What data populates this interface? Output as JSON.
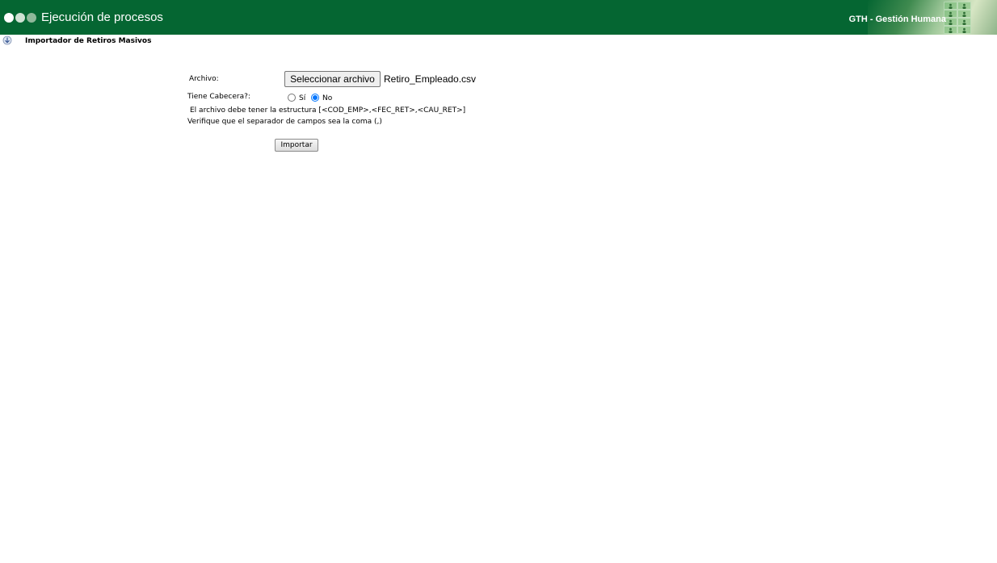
{
  "header": {
    "title": "Ejecución de procesos",
    "app_name": "GTH - Gestión Humana"
  },
  "section": {
    "title": "Importador de Retiros Masivos"
  },
  "form": {
    "file_label": "Archivo:",
    "file_button_label": "Seleccionar archivo",
    "file_name": "Retiro_Empleado.csv",
    "header_label": "Tiene Cabecera?:",
    "header_options": [
      {
        "label": "Sí",
        "selected": false
      },
      {
        "label": "No",
        "selected": true
      }
    ],
    "structure_note": "El archivo debe tener la estructura [<COD_EMP>,<FEC_RET>,<CAU_RET>]",
    "separator_note": "Verifique que el separador de campos sea la coma (,)",
    "import_button_label": "Importar"
  },
  "colors": {
    "header_green": "#056632",
    "radio_accent": "#0075ff"
  }
}
